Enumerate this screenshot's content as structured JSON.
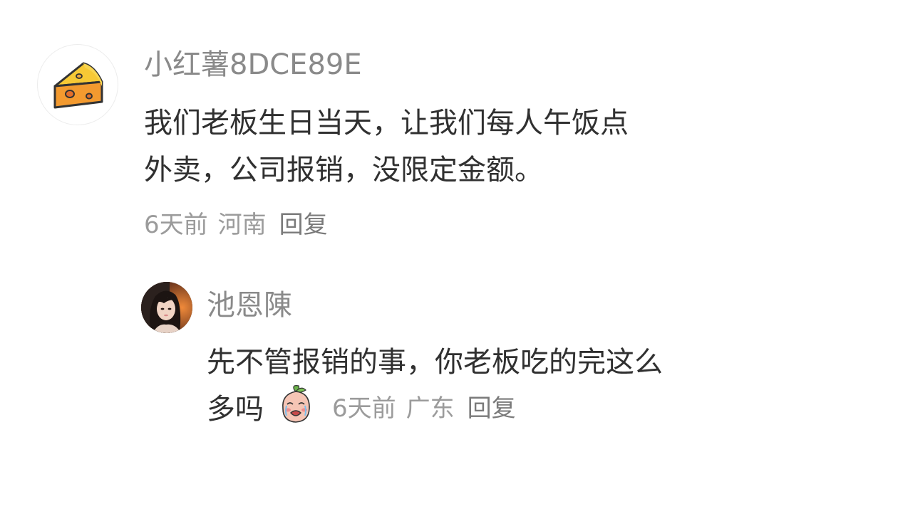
{
  "comments": [
    {
      "avatar_icon": "cheese-icon",
      "username": "小红薯8DCE89E",
      "text_line1": "我们老板生日当天，让我们每人午饭点",
      "text_line2": "外卖，公司报销，没限定金额。",
      "time": "6天前",
      "location": "河南",
      "reply_label": "回复"
    }
  ],
  "replies": [
    {
      "avatar_icon": "user-photo-avatar",
      "username": "池恩陳",
      "text_line1": "先不管报销的事，你老板吃的完这么",
      "text_line2": "多吗",
      "sticker_icon": "crying-peach-sticker-icon",
      "time": "6天前",
      "location": "广东",
      "reply_label": "回复"
    }
  ],
  "colors": {
    "username": "#8a8a8a",
    "content_text": "#303030",
    "meta_text": "#9b9b9b",
    "cheese": "#f7c230",
    "cheese_shadow": "#f08a2c"
  }
}
